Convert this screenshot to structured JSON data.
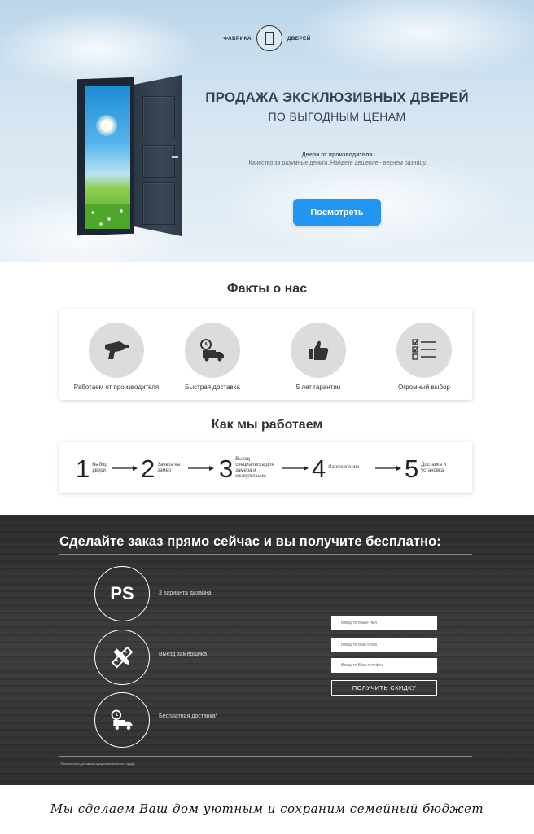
{
  "logo": {
    "left_text": "ФАБРИКА",
    "right_text": "ДВЕРЕЙ"
  },
  "hero": {
    "title": "ПРОДАЖА ЭКСКЛЮЗИВНЫХ ДВЕРЕЙ",
    "subtitle": "ПО ВЫГОДНЫМ ЦЕНАМ",
    "lead": "Двери от производителя.",
    "lead_2": "Качество за разумные деньги. Найдете дешевле - вернем разницу.",
    "button_label": "Посмотреть"
  },
  "facts": {
    "title": "Факты о нас",
    "items": [
      {
        "label": "Работаем от производителя",
        "icon": "drill-icon"
      },
      {
        "label": "Быстрая доставка",
        "icon": "delivery-truck-icon"
      },
      {
        "label": "5 лет гарантии",
        "icon": "thumbs-up-icon"
      },
      {
        "label": "Огромный выбор",
        "icon": "checklist-icon"
      }
    ]
  },
  "steps": {
    "title": "Как мы работаем",
    "items": [
      {
        "num": "1",
        "text": "Выбор двери"
      },
      {
        "num": "2",
        "text": "Заявка на замер"
      },
      {
        "num": "3",
        "text": "Выезд специалиста для замера и консультации"
      },
      {
        "num": "4",
        "text": "Изготовление"
      },
      {
        "num": "5",
        "text": "Доставка и установка"
      }
    ]
  },
  "offer": {
    "title": "Сделайте заказ прямо сейчас и вы получите бесплатно:",
    "gifts": [
      {
        "label": "3 варианта дизайна",
        "icon_text": "PS"
      },
      {
        "label": "Выезд замерщика",
        "icon": "ruler-pencil-icon"
      },
      {
        "label": "Бесплатная доставка*",
        "icon": "delivery-truck-icon"
      }
    ],
    "form": {
      "name_placeholder": "Введите Ваше имя",
      "email_placeholder": "Введите Ваш email",
      "phone_placeholder": "Введите Ваш телефон",
      "submit_label": "ПОЛУЧИТЬ СКИДКУ"
    },
    "footnote": "*Бесплатная доставка осуществляется по городу."
  },
  "slogan": "Мы сделаем Ваш дом уютным и сохраним семейный бюджет"
}
